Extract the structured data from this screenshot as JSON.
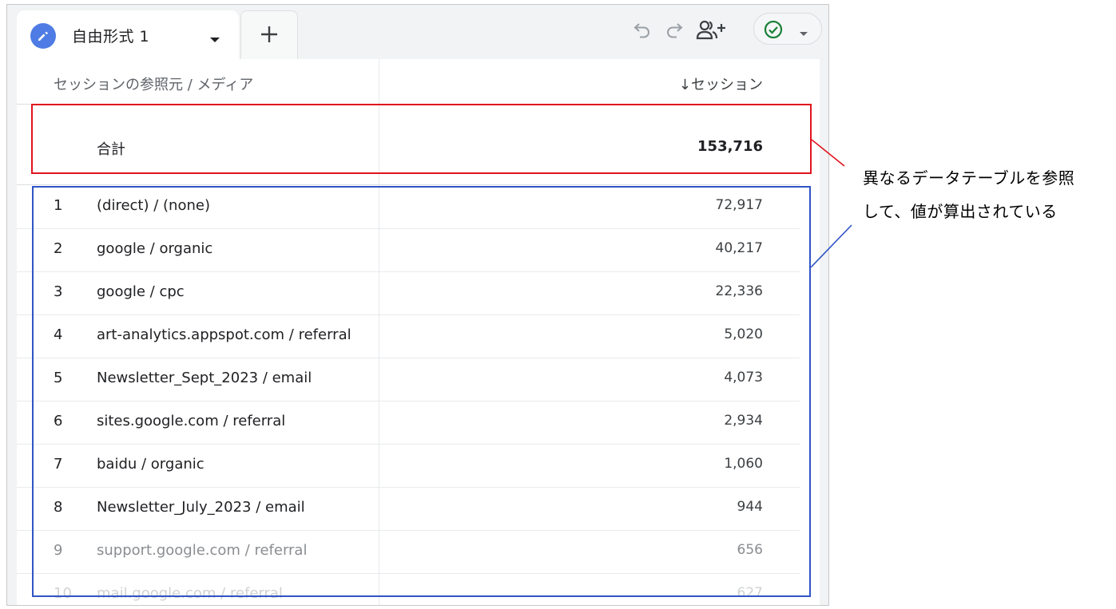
{
  "tab": {
    "title": "自由形式 1",
    "add_label": "+"
  },
  "table": {
    "dimension_header": "セッションの参照元 / メディア",
    "metric_header": "↓セッション",
    "total_label": "合計",
    "total_value": "153,716",
    "rows": [
      {
        "num": "1",
        "dim": "(direct) / (none)",
        "val": "72,917"
      },
      {
        "num": "2",
        "dim": "google / organic",
        "val": "40,217"
      },
      {
        "num": "3",
        "dim": "google / cpc",
        "val": "22,336"
      },
      {
        "num": "4",
        "dim": "art-analytics.appspot.com / referral",
        "val": "5,020"
      },
      {
        "num": "5",
        "dim": "Newsletter_Sept_2023 / email",
        "val": "4,073"
      },
      {
        "num": "6",
        "dim": "sites.google.com / referral",
        "val": "2,934"
      },
      {
        "num": "7",
        "dim": "baidu / organic",
        "val": "1,060"
      },
      {
        "num": "8",
        "dim": "Newsletter_July_2023 / email",
        "val": "944"
      },
      {
        "num": "9",
        "dim": "support.google.com / referral",
        "val": "656"
      },
      {
        "num": "10",
        "dim": "mail.google.com / referral",
        "val": "627"
      }
    ]
  },
  "annotation": {
    "line1": "異なるデータテーブルを参照",
    "line2": "して、値が算出されている"
  },
  "colors": {
    "highlight_total": "#e0141e",
    "highlight_rows": "#2f54c5",
    "tab_icon": "#4f7ce4",
    "status_check": "#188038"
  },
  "icons": [
    "pencil-icon",
    "caret-down-icon",
    "plus-icon",
    "undo-icon",
    "redo-icon",
    "share-users-icon",
    "check-circle-icon"
  ]
}
